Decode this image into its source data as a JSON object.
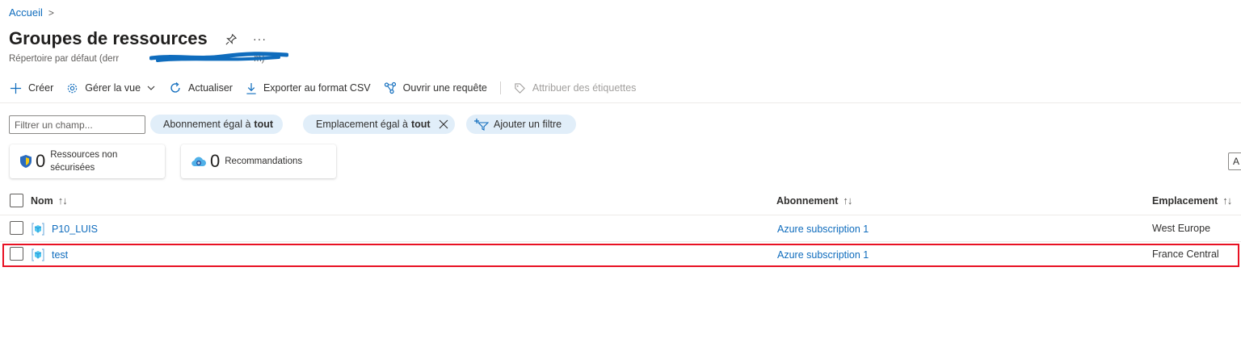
{
  "breadcrumb": {
    "home": "Accueil",
    "separator": ">"
  },
  "page": {
    "title": "Groupes de ressources",
    "more": "···",
    "subtitle": "Répertoire par défaut (derr",
    "subtitle_end": "m)"
  },
  "toolbar": {
    "create": "Créer",
    "manage_view": "Gérer la vue",
    "refresh": "Actualiser",
    "export_csv": "Exporter au format CSV",
    "open_query": "Ouvrir une requête",
    "assign_tags": "Attribuer des étiquettes"
  },
  "filters": {
    "field_placeholder": "Filtrer un champ...",
    "subscription_pill": {
      "label": "Abonnement égal à",
      "value": "tout"
    },
    "location_pill": {
      "label": "Emplacement égal à",
      "value": "tout"
    },
    "add_filter": "Ajouter un filtre"
  },
  "cards": {
    "unsecured": {
      "count": "0",
      "line1": "Ressources non",
      "line2": "sécurisées"
    },
    "recommendations": {
      "count": "0",
      "label": "Recommandations"
    }
  },
  "right_box": "A",
  "table": {
    "columns": {
      "name": "Nom",
      "subscription": "Abonnement",
      "location": "Emplacement"
    },
    "sort_glyph": "↑↓",
    "rows": [
      {
        "name": "P10_LUIS",
        "subscription": "Azure subscription 1",
        "location": "West Europe"
      },
      {
        "name": "test",
        "subscription": "Azure subscription 1",
        "location": "France Central"
      }
    ]
  },
  "colors": {
    "link": "#0f6cbd",
    "pill_bg": "#e1eef9",
    "highlight_border": "#e81123",
    "redaction": "#0f6cbd"
  },
  "icons": [
    "chevron-right-icon",
    "pin-icon",
    "more-icon",
    "plus-icon",
    "gear-icon",
    "chevron-down-icon",
    "refresh-icon",
    "download-icon",
    "query-icon",
    "tag-icon",
    "close-icon",
    "add-filter-icon",
    "shield-icon",
    "recommendation-cloud-icon",
    "resource-group-icon",
    "sort-icon"
  ]
}
